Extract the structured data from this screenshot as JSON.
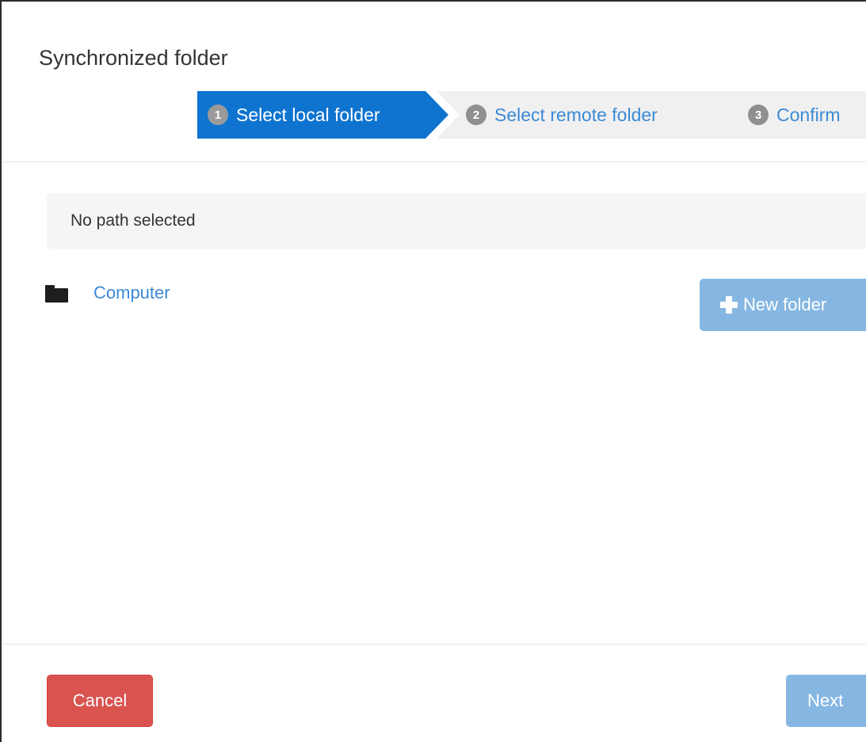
{
  "dialog": {
    "title": "Synchronized folder"
  },
  "wizard": {
    "steps": [
      {
        "number": "1",
        "label": "Select local folder",
        "state": "active"
      },
      {
        "number": "2",
        "label": "Select remote folder",
        "state": "inactive"
      },
      {
        "number": "3",
        "label": "Confirm",
        "state": "inactive"
      }
    ]
  },
  "path_bar": {
    "text": "No path selected"
  },
  "tree": {
    "items": [
      {
        "label": "Computer",
        "icon": "folder-icon"
      }
    ]
  },
  "toolbar": {
    "new_folder_label": "New folder",
    "new_folder_icon": "plus-icon"
  },
  "footer": {
    "cancel_label": "Cancel",
    "next_label": "Next"
  },
  "colors": {
    "active_step": "#0f74d0",
    "inactive_step": "#f0f0f0",
    "link": "#3b8ad6",
    "cancel_button": "#d9534f",
    "disabled_primary_button": "#86b7e3"
  }
}
